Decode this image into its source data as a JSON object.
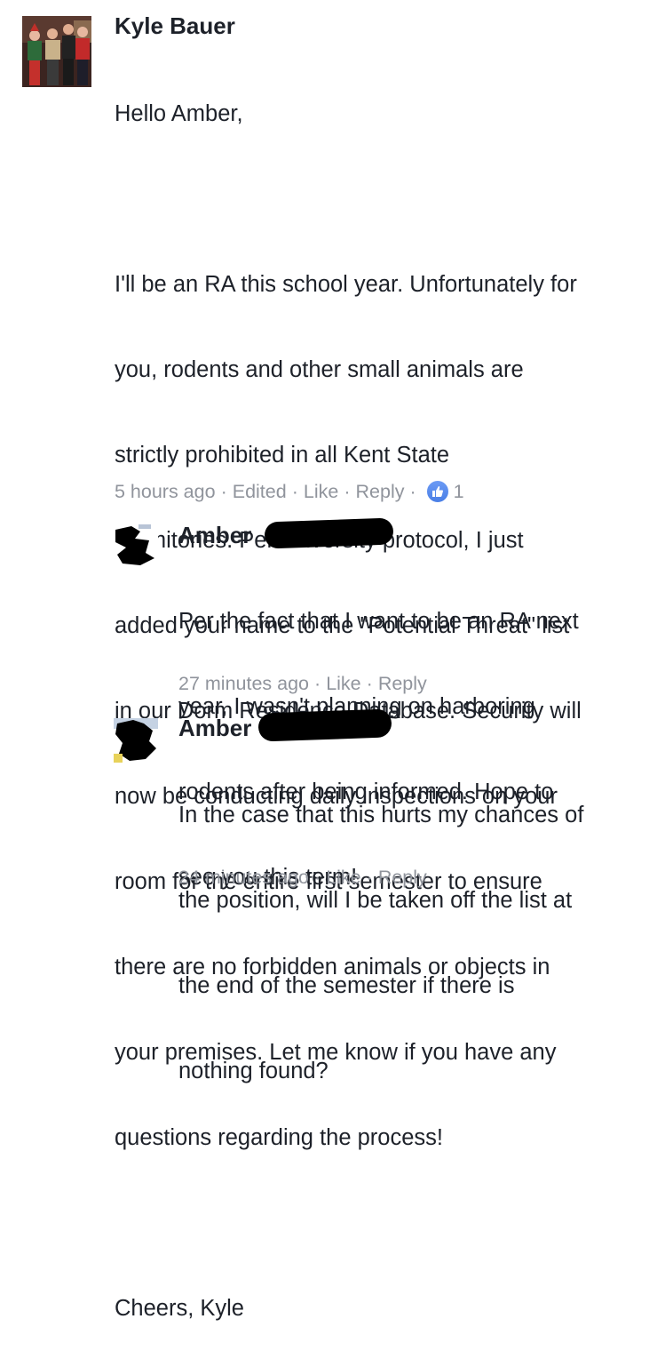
{
  "main_comment": {
    "author": "Kyle Bauer",
    "lines": [
      "Hello Amber,",
      "",
      "I'll be an RA this school year. Unfortunately for",
      "you, rodents and other small animals are",
      "strictly prohibited in all Kent State",
      "dormitories. Per university protocol, I just",
      "added your name to the \"Potential Threat\" list",
      "in our Dorm Residence Database. Security will",
      "now be conducting daily inspections on your",
      "room for the entire first semester to ensure",
      "there are no forbidden animals or objects in",
      "your premises. Let me know if you have any",
      "questions regarding the process!",
      "",
      "Cheers, Kyle"
    ],
    "time": "5 hours ago",
    "edited": "Edited",
    "like_label": "Like",
    "reply_label": "Reply",
    "like_count": "1",
    "separator": "·"
  },
  "replies": [
    {
      "author": "Amber",
      "lines": [
        "Per the fact that I want to be an RA next",
        "year, I wasn't planning on harboring",
        "rodents after being informed. Hope to",
        "see you this term!"
      ],
      "time": "27 minutes ago",
      "like_label": "Like",
      "reply_label": "Reply"
    },
    {
      "author": "Amber",
      "lines": [
        "In the case that this hurts my chances of",
        "the position, will I be taken off the list at",
        "the end of the semester if there is",
        "nothing found?"
      ],
      "time": "24 minutes ago",
      "like_label": "Like",
      "reply_label": "Reply"
    }
  ],
  "colors": {
    "text": "#1d2129",
    "meta": "#90949c",
    "like_badge": "#5890ff"
  }
}
